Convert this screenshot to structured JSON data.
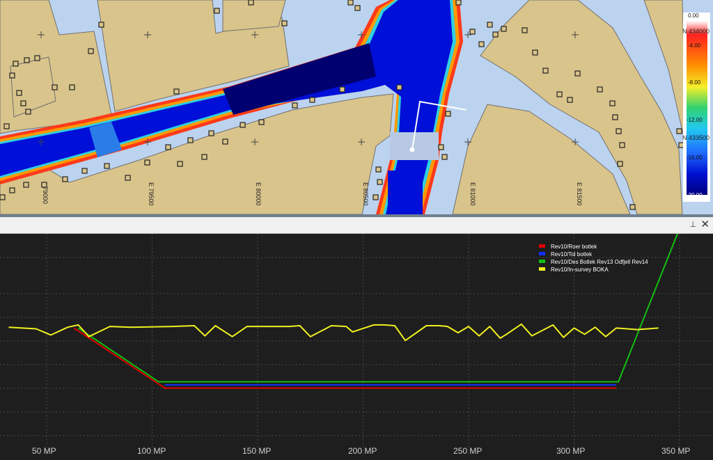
{
  "map": {
    "colorbar": {
      "labels": [
        "0.00",
        "-4.00",
        "-8.00",
        "-12.00",
        "-16.00",
        "-20.00"
      ],
      "stops": [
        "#ffffff",
        "#ff2020",
        "#ff8c00",
        "#f5ee2a",
        "#30d270",
        "#22c8f0",
        "#2070ff",
        "#0010d0",
        "#000080"
      ]
    },
    "eastings": [
      "79000",
      "E 79500",
      "E 80000",
      "E 80500",
      "E 81000",
      "E 81500"
    ],
    "northings": [
      "N 434000",
      "N 433500"
    ]
  },
  "panel": {
    "pin_icon": "⊥",
    "close_icon": "✕"
  },
  "legend": [
    {
      "label": "Rev10/Roer botlek",
      "color": "#e00000"
    },
    {
      "label": "Rev10/Tol botlek",
      "color": "#1030ff"
    },
    {
      "label": "Rev10/Des Botlek Rev13 Odfjell Rev14",
      "color": "#10c010"
    },
    {
      "label": "Rev10/In-survey BOKA",
      "color": "#f0f020"
    }
  ],
  "xaxis": {
    "ticks": [
      "50 MP",
      "100 MP",
      "150 MP",
      "200 MP",
      "250 MP",
      "300 MP",
      "350 MP"
    ]
  },
  "chart_data": {
    "type": "line",
    "xlabel": "",
    "ylabel": "",
    "x_unit": "MP",
    "grid": true,
    "legend_position": "top-right",
    "series": [
      {
        "name": "Rev10/Roer botlek",
        "color": "#e00000",
        "x": [
          63,
          106,
          320
        ],
        "y": [
          -12.8,
          -20.5,
          -20.5
        ]
      },
      {
        "name": "Rev10/Tol botlek",
        "color": "#1030ff",
        "x": [
          106,
          320
        ],
        "y": [
          -20.1,
          -20.1
        ]
      },
      {
        "name": "Rev10/Des Botlek Rev13 Odfjell Rev14",
        "color": "#10c010",
        "x": [
          65,
          103,
          321,
          353
        ],
        "y": [
          -12.8,
          -19.7,
          -19.7,
          2.0
        ]
      },
      {
        "name": "Rev10/In-survey BOKA",
        "color": "#f0f020",
        "x": [
          32,
          45,
          52,
          60,
          65,
          70,
          80,
          90,
          110,
          120,
          125,
          130,
          138,
          145,
          150,
          155,
          165,
          170,
          175,
          185,
          192,
          195,
          205,
          210,
          215,
          220,
          230,
          236,
          240,
          245,
          250,
          255,
          260,
          265,
          268,
          275,
          280,
          290,
          295,
          300,
          305,
          310,
          315,
          320,
          330,
          340
        ],
        "y": [
          -12.7,
          -12.9,
          -13.7,
          -12.7,
          -12.4,
          -13.9,
          -12.6,
          -12.7,
          -12.6,
          -12.5,
          -13.8,
          -12.5,
          -13.9,
          -12.6,
          -12.6,
          -12.6,
          -12.6,
          -12.5,
          -13.9,
          -12.5,
          -12.6,
          -13.3,
          -12.4,
          -12.4,
          -12.5,
          -14.4,
          -12.5,
          -12.5,
          -12.6,
          -13.4,
          -12.6,
          -13.8,
          -12.6,
          -14.1,
          -13.6,
          -12.3,
          -13.8,
          -12.4,
          -14.0,
          -12.8,
          -13.6,
          -12.7,
          -13.9,
          -12.8,
          -13.0,
          -12.8
        ]
      }
    ]
  }
}
